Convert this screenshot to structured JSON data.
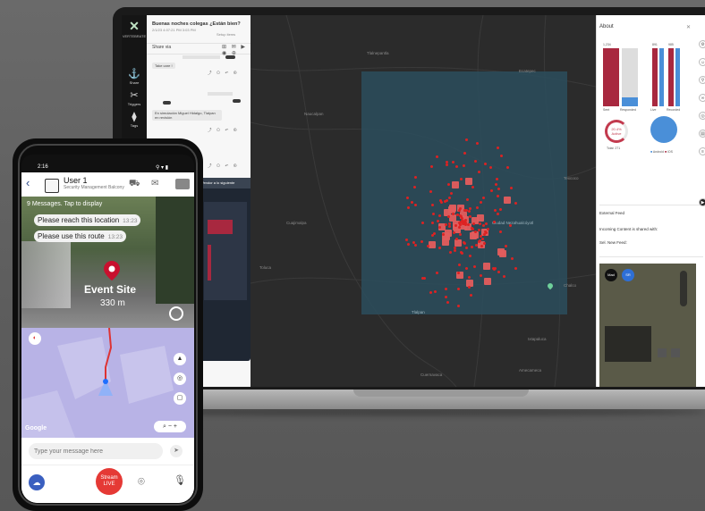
{
  "laptop": {
    "rail": {
      "brand": "VERTEBRATE",
      "items": [
        {
          "icon": "share-icon",
          "glyph": "⚓",
          "label": "Share"
        },
        {
          "icon": "triggers-icon",
          "glyph": "✂",
          "label": "Triggers"
        },
        {
          "icon": "tags-icon",
          "glyph": "⧫",
          "label": "Tags"
        }
      ]
    },
    "chat": {
      "title": "Buenas noches colegas ¿Están bien?",
      "subtitle": "2/1/23 4:07:21 PM 3:03 PM",
      "subtitle2": "Setup items",
      "share_label": "Share via",
      "messages": [
        {
          "text": "Take care !",
          "time": ""
        },
        {
          "text": "En simulación Miguel Hidalgo, Tlalpan en revisión",
          "time": ""
        }
      ],
      "overlay_title": "Vendor a lo siguiente"
    },
    "about": {
      "title": "About",
      "chart1": {
        "labels": [
          "Sent",
          "Responded"
        ],
        "values": [
          "1,234",
          "271"
        ]
      },
      "chart2": {
        "labels": [
          "Live",
          "Recorded"
        ],
        "values": [
          "891",
          "985"
        ]
      },
      "donut": {
        "percent": "20.4%",
        "label": "Active",
        "total": "Total: 271"
      },
      "pie_legend": [
        "Android",
        "iOS"
      ],
      "external_feed": "External Feed",
      "incoming": "Incoming Content is shared with:",
      "sel": "Sel. New Feed:",
      "thumb_buttons": [
        "Mad",
        "SR"
      ]
    },
    "map_labels": [
      "Tlalnepantla",
      "Ecatepec",
      "Naucalpan",
      "Ciudad Nezahualcóyotl",
      "Tlalpan",
      "Cuajimalpa",
      "Texcoco",
      "Chalco",
      "Toluca",
      "Ixtapaluca",
      "Amecameca",
      "Cuernavaca"
    ],
    "colors": {
      "accent": "#a8283f",
      "blue": "#4a8fd8",
      "cluster": "#e35d5d",
      "region": "#2b4e5d"
    }
  },
  "phone": {
    "status_time": "2:16",
    "user_name": "User 1",
    "user_role": "Security Management Balcony",
    "messages_count": "9 Messages. Tap to display",
    "messages": [
      {
        "text": "Please reach this location",
        "time": "13:23"
      },
      {
        "text": "Please use this route",
        "time": "13:23"
      }
    ],
    "event_name": "Event Site",
    "event_distance": "330 m",
    "map_brand": "Google",
    "input_placeholder": "Type your message here",
    "stream_label_1": "Stream",
    "stream_label_2": "LIVE"
  }
}
